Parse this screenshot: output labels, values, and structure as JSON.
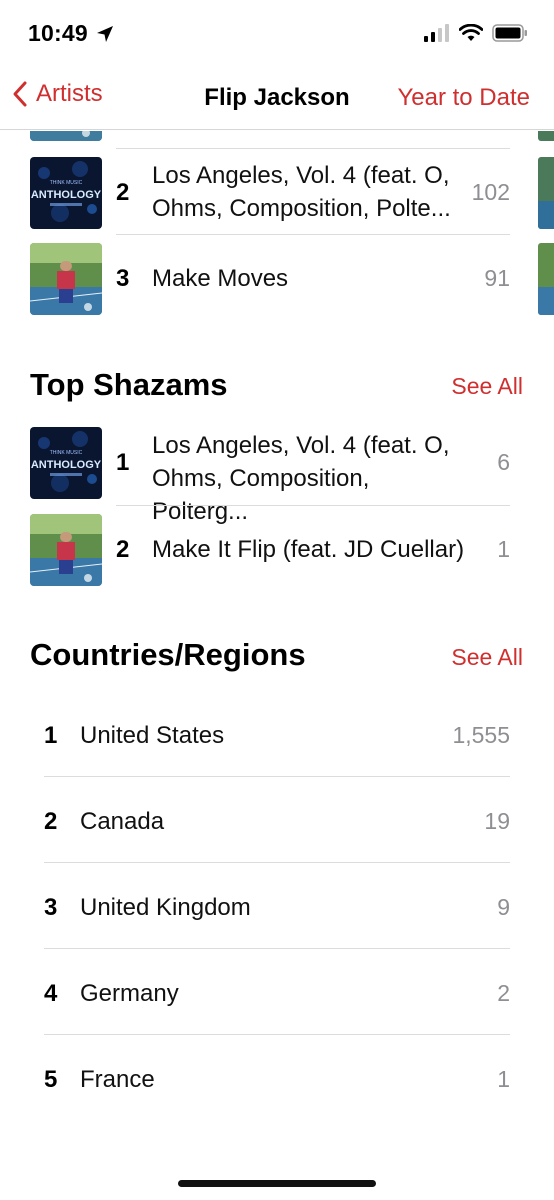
{
  "status_bar": {
    "time": "10:49"
  },
  "nav": {
    "back_label": "Artists",
    "title": "Flip Jackson",
    "right_label": "Year to Date"
  },
  "top_songs": {
    "items": [
      {
        "rank": "2",
        "title": "Los Angeles, Vol. 4 (feat. O, Ohms, Composition, Polte...",
        "count": "102",
        "art": "anthology"
      },
      {
        "rank": "3",
        "title": "Make Moves",
        "count": "91",
        "art": "court"
      }
    ]
  },
  "top_shazams": {
    "title": "Top Shazams",
    "see_all": "See All",
    "items": [
      {
        "rank": "1",
        "title": "Los Angeles, Vol. 4 (feat. O, Ohms, Composition, Polterg...",
        "count": "6",
        "art": "anthology"
      },
      {
        "rank": "2",
        "title": "Make It Flip (feat. JD Cuellar)",
        "count": "1",
        "art": "court"
      }
    ]
  },
  "countries": {
    "title": "Countries/Regions",
    "see_all": "See All",
    "items": [
      {
        "rank": "1",
        "name": "United States",
        "count": "1,555"
      },
      {
        "rank": "2",
        "name": "Canada",
        "count": "19"
      },
      {
        "rank": "3",
        "name": "United Kingdom",
        "count": "9"
      },
      {
        "rank": "4",
        "name": "Germany",
        "count": "2"
      },
      {
        "rank": "5",
        "name": "France",
        "count": "1"
      }
    ]
  },
  "art_text": {
    "anthology": "ANTHOLOGY"
  },
  "colors": {
    "accent": "#d02f2f",
    "secondary_text": "#8e8e93",
    "separator": "#dcdcdc"
  }
}
